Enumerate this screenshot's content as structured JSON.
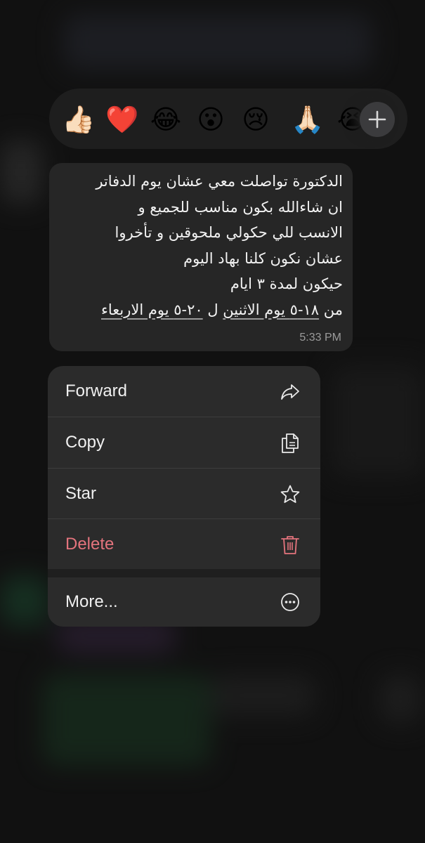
{
  "reactions": {
    "emojis": [
      "👍🏻",
      "❤️",
      "😂",
      "😮",
      "😢",
      "🙏🏻",
      "😭"
    ],
    "more_icon": "plus-icon"
  },
  "message": {
    "lines": [
      "الدكتورة تواصلت معي عشان يوم الدفاتر",
      "ان شاءالله بكون مناسب للجميع و",
      "الانسب للي حكولي ملحوقين و تأخروا",
      "عشان نكون كلنا بهاد اليوم",
      "حيكون لمدة ٣ ايام"
    ],
    "last_line": {
      "prefix": "من ",
      "link1": "١٨-٥ يوم الاثنين",
      "middle": " ل ",
      "link2": "٢٠-٥ يوم الاربعاء"
    },
    "time": "5:33 PM"
  },
  "menu": {
    "items": [
      {
        "label": "Forward",
        "icon": "share-arrow-icon"
      },
      {
        "label": "Copy",
        "icon": "copy-icon"
      },
      {
        "label": "Star",
        "icon": "star-icon"
      },
      {
        "label": "Delete",
        "icon": "trash-icon",
        "color": "#e4747d"
      },
      {
        "label": "More...",
        "icon": "ellipsis-circle-icon"
      }
    ]
  }
}
